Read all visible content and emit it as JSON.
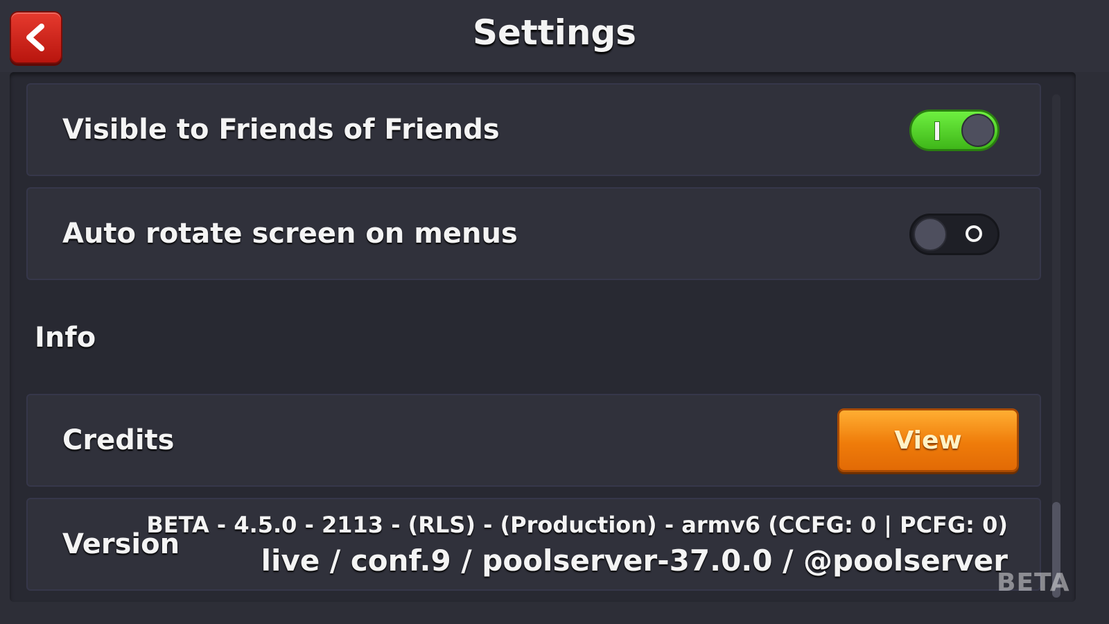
{
  "header": {
    "title": "Settings",
    "back_icon": "chevron-left-icon"
  },
  "settings": {
    "friends_of_friends": {
      "label": "Visible to Friends of Friends",
      "enabled": true
    },
    "auto_rotate": {
      "label": "Auto rotate screen on menus",
      "enabled": false
    }
  },
  "info": {
    "section_label": "Info",
    "credits": {
      "label": "Credits",
      "button_label": "View"
    },
    "version": {
      "label": "Version",
      "line1": "BETA - 4.5.0 - 2113 - (RLS) - (Production) - armv6 (CCFG: 0 | PCFG: 0)",
      "line2": "live / conf.9 / poolserver-37.0.0 / @poolserver"
    }
  },
  "watermark": "BETA",
  "colors": {
    "toggle_on": "#4fd226",
    "button_orange": "#ef7c0a",
    "back_red": "#d42a1f",
    "background": "#2d2e37"
  }
}
